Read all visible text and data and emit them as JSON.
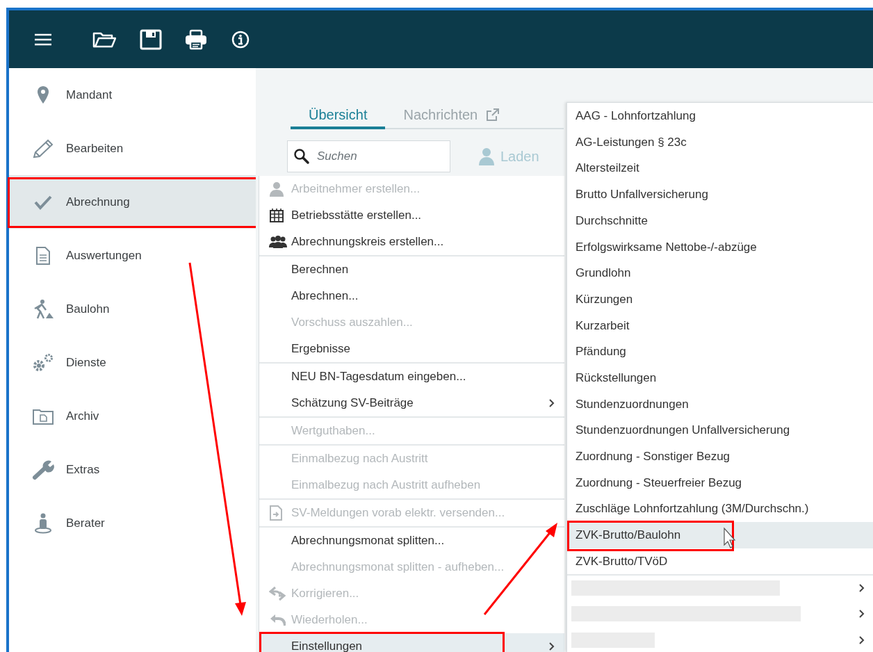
{
  "toolbar": {
    "buttons": [
      {
        "kind": "menu"
      },
      {
        "kind": "open"
      },
      {
        "kind": "save"
      },
      {
        "kind": "print"
      },
      {
        "kind": "info"
      }
    ]
  },
  "sidebar": {
    "items": [
      {
        "label": "Mandant",
        "selected": false,
        "annotated": false
      },
      {
        "label": "Bearbeiten",
        "selected": false,
        "annotated": false
      },
      {
        "label": "Abrechnung",
        "selected": true,
        "annotated": true
      },
      {
        "label": "Auswertungen",
        "selected": false,
        "annotated": false
      },
      {
        "label": "Baulohn",
        "selected": false,
        "annotated": false
      },
      {
        "label": "Dienste",
        "selected": false,
        "annotated": false
      },
      {
        "label": "Archiv",
        "selected": false,
        "annotated": false
      },
      {
        "label": "Extras",
        "selected": false,
        "annotated": false
      },
      {
        "label": "Berater",
        "selected": false,
        "annotated": false
      }
    ]
  },
  "tabs": [
    {
      "label": "Übersicht",
      "selected": true
    },
    {
      "label": "Nachrichten",
      "selected": false
    }
  ],
  "search": {
    "placeholder": "Suchen"
  },
  "load_button": {
    "label": "Laden",
    "disabled": true
  },
  "menu": {
    "groups": [
      [
        {
          "label": "Arbeitnehmer erstellen...",
          "disabled": true,
          "has_submenu": false,
          "selected": false,
          "annotated": false
        },
        {
          "label": "Betriebsstätte erstellen...",
          "disabled": false,
          "has_submenu": false,
          "selected": false,
          "annotated": false
        },
        {
          "label": "Abrechnungskreis erstellen...",
          "disabled": false,
          "has_submenu": false,
          "selected": false,
          "annotated": false
        }
      ],
      [
        {
          "label": "Berechnen",
          "disabled": false,
          "has_submenu": false,
          "selected": false,
          "annotated": false
        },
        {
          "label": "Abrechnen...",
          "disabled": false,
          "has_submenu": false,
          "selected": false,
          "annotated": false
        },
        {
          "label": "Vorschuss auszahlen...",
          "disabled": true,
          "has_submenu": false,
          "selected": false,
          "annotated": false
        },
        {
          "label": "Ergebnisse",
          "disabled": false,
          "has_submenu": false,
          "selected": false,
          "annotated": false
        }
      ],
      [
        {
          "label": "NEU BN-Tagesdatum eingeben...",
          "disabled": false,
          "has_submenu": false,
          "selected": false,
          "annotated": false
        },
        {
          "label": "Schätzung SV-Beiträge",
          "disabled": false,
          "has_submenu": true,
          "selected": false,
          "annotated": false
        }
      ],
      [
        {
          "label": "Wertguthaben...",
          "disabled": true,
          "has_submenu": false,
          "selected": false,
          "annotated": false
        }
      ],
      [
        {
          "label": "Einmalbezug nach Austritt",
          "disabled": true,
          "has_submenu": false,
          "selected": false,
          "annotated": false
        },
        {
          "label": "Einmalbezug nach Austritt aufheben",
          "disabled": true,
          "has_submenu": false,
          "selected": false,
          "annotated": false
        }
      ],
      [
        {
          "label": "SV-Meldungen vorab elektr. versenden...",
          "disabled": true,
          "has_submenu": false,
          "selected": false,
          "annotated": false
        }
      ],
      [
        {
          "label": "Abrechnungsmonat splitten...",
          "disabled": false,
          "has_submenu": false,
          "selected": false,
          "annotated": false
        },
        {
          "label": "Abrechnungsmonat splitten - aufheben...",
          "disabled": true,
          "has_submenu": false,
          "selected": false,
          "annotated": false
        },
        {
          "label": "Korrigieren...",
          "disabled": true,
          "has_submenu": false,
          "selected": false,
          "annotated": false
        },
        {
          "label": "Wiederholen...",
          "disabled": true,
          "has_submenu": false,
          "selected": false,
          "annotated": false
        },
        {
          "label": "Einstellungen",
          "disabled": false,
          "has_submenu": true,
          "selected": true,
          "annotated": true
        }
      ]
    ]
  },
  "submenu": {
    "items": [
      {
        "kind": "entry",
        "label": "AAG - Lohnfortzahlung",
        "selected": false,
        "annotated": false
      },
      {
        "kind": "entry",
        "label": "AG-Leistungen § 23c",
        "selected": false,
        "annotated": false
      },
      {
        "kind": "entry",
        "label": "Altersteilzeit",
        "selected": false,
        "annotated": false
      },
      {
        "kind": "entry",
        "label": "Brutto Unfallversicherung",
        "selected": false,
        "annotated": false
      },
      {
        "kind": "entry",
        "label": "Durchschnitte",
        "selected": false,
        "annotated": false
      },
      {
        "kind": "entry",
        "label": "Erfolgswirksame Nettobe-/-abzüge",
        "selected": false,
        "annotated": false
      },
      {
        "kind": "entry",
        "label": "Grundlohn",
        "selected": false,
        "annotated": false
      },
      {
        "kind": "entry",
        "label": "Kürzungen",
        "selected": false,
        "annotated": false
      },
      {
        "kind": "entry",
        "label": "Kurzarbeit",
        "selected": false,
        "annotated": false
      },
      {
        "kind": "entry",
        "label": "Pfändung",
        "selected": false,
        "annotated": false
      },
      {
        "kind": "entry",
        "label": "Rückstellungen",
        "selected": false,
        "annotated": false
      },
      {
        "kind": "entry",
        "label": "Stundenzuordnungen",
        "selected": false,
        "annotated": false
      },
      {
        "kind": "entry",
        "label": "Stundenzuordnungen Unfallversicherung",
        "selected": false,
        "annotated": false
      },
      {
        "kind": "entry",
        "label": "Zuordnung - Sonstiger Bezug",
        "selected": false,
        "annotated": false
      },
      {
        "kind": "entry",
        "label": "Zuordnung - Steuerfreier Bezug",
        "selected": false,
        "annotated": false
      },
      {
        "kind": "entry",
        "label": "Zuschläge Lohnfortzahlung (3M/Durchschn.)",
        "selected": false,
        "annotated": false
      },
      {
        "kind": "entry",
        "label": "ZVK-Brutto/Baulohn",
        "selected": true,
        "annotated": true
      },
      {
        "kind": "entry",
        "label": "ZVK-Brutto/TVöD",
        "selected": false,
        "annotated": false
      },
      {
        "kind": "redacted",
        "has_submenu": true,
        "selected": false
      },
      {
        "kind": "redacted",
        "has_submenu": true,
        "selected": false
      },
      {
        "kind": "redacted",
        "has_submenu": true,
        "selected": false
      }
    ]
  }
}
